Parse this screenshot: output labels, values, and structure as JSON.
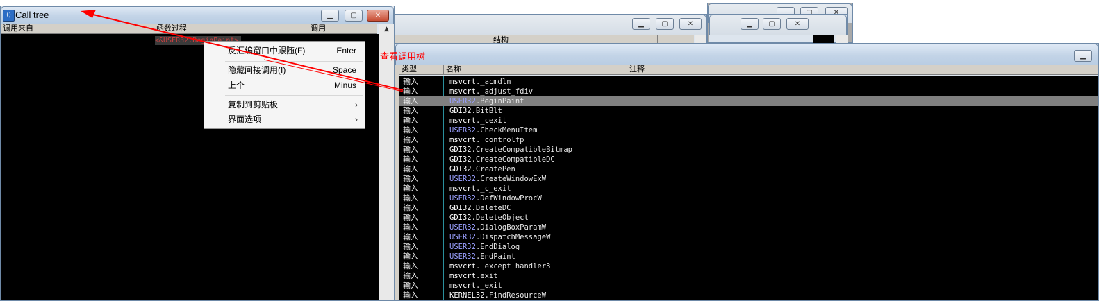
{
  "call_tree_window": {
    "title": "Call tree",
    "columns": [
      "调用来自",
      "函数过程",
      "调用"
    ],
    "selected_entry": "<&USER32.BeginPaint>"
  },
  "context_menu": {
    "items": [
      {
        "label": "反汇编窗口中跟随(F)",
        "shortcut": "Enter"
      },
      {
        "label": "隐藏间接调用(I)",
        "shortcut": "Space"
      },
      {
        "label": "上个",
        "shortcut": "Minus"
      },
      {
        "label": "复制到剪贴板",
        "shortcut": "",
        "submenu": true
      },
      {
        "label": "界面选项",
        "shortcut": "",
        "submenu": true
      }
    ]
  },
  "annotation": {
    "text": "查看调用树",
    "color": "#ff0000"
  },
  "background_windows": {
    "structure_header": "结构"
  },
  "names_window": {
    "columns": [
      "类型",
      "名称",
      "注释"
    ],
    "selected_index": 2,
    "rows": [
      {
        "kind": "输入",
        "module": "msvcrt",
        "func": "_acmdln"
      },
      {
        "kind": "输入",
        "module": "msvcrt",
        "func": "_adjust_fdiv"
      },
      {
        "kind": "输入",
        "module": "USER32",
        "func": "BeginPaint"
      },
      {
        "kind": "输入",
        "module": "GDI32",
        "func": "BitBlt"
      },
      {
        "kind": "输入",
        "module": "msvcrt",
        "func": "_cexit"
      },
      {
        "kind": "输入",
        "module": "USER32",
        "func": "CheckMenuItem"
      },
      {
        "kind": "输入",
        "module": "msvcrt",
        "func": "_controlfp"
      },
      {
        "kind": "输入",
        "module": "GDI32",
        "func": "CreateCompatibleBitmap"
      },
      {
        "kind": "输入",
        "module": "GDI32",
        "func": "CreateCompatibleDC"
      },
      {
        "kind": "输入",
        "module": "GDI32",
        "func": "CreatePen"
      },
      {
        "kind": "输入",
        "module": "USER32",
        "func": "CreateWindowExW"
      },
      {
        "kind": "输入",
        "module": "msvcrt",
        "func": "_c_exit"
      },
      {
        "kind": "输入",
        "module": "USER32",
        "func": "DefWindowProcW"
      },
      {
        "kind": "输入",
        "module": "GDI32",
        "func": "DeleteDC"
      },
      {
        "kind": "输入",
        "module": "GDI32",
        "func": "DeleteObject"
      },
      {
        "kind": "输入",
        "module": "USER32",
        "func": "DialogBoxParamW"
      },
      {
        "kind": "输入",
        "module": "USER32",
        "func": "DispatchMessageW"
      },
      {
        "kind": "输入",
        "module": "USER32",
        "func": "EndDialog"
      },
      {
        "kind": "输入",
        "module": "USER32",
        "func": "EndPaint"
      },
      {
        "kind": "输入",
        "module": "msvcrt",
        "func": "_except_handler3"
      },
      {
        "kind": "输入",
        "module": "msvcrt",
        "func": "exit"
      },
      {
        "kind": "输入",
        "module": "msvcrt",
        "func": "_exit"
      },
      {
        "kind": "输入",
        "module": "KERNEL32",
        "func": "FindResourceW"
      }
    ]
  },
  "window_controls": {
    "minimize": "▁",
    "maximize": "▢",
    "close": "✕"
  },
  "colors": {
    "pane_bg": "#000000",
    "grid_line": "#2a8f9c",
    "selection": "#808080",
    "annotation": "#ff0000"
  }
}
